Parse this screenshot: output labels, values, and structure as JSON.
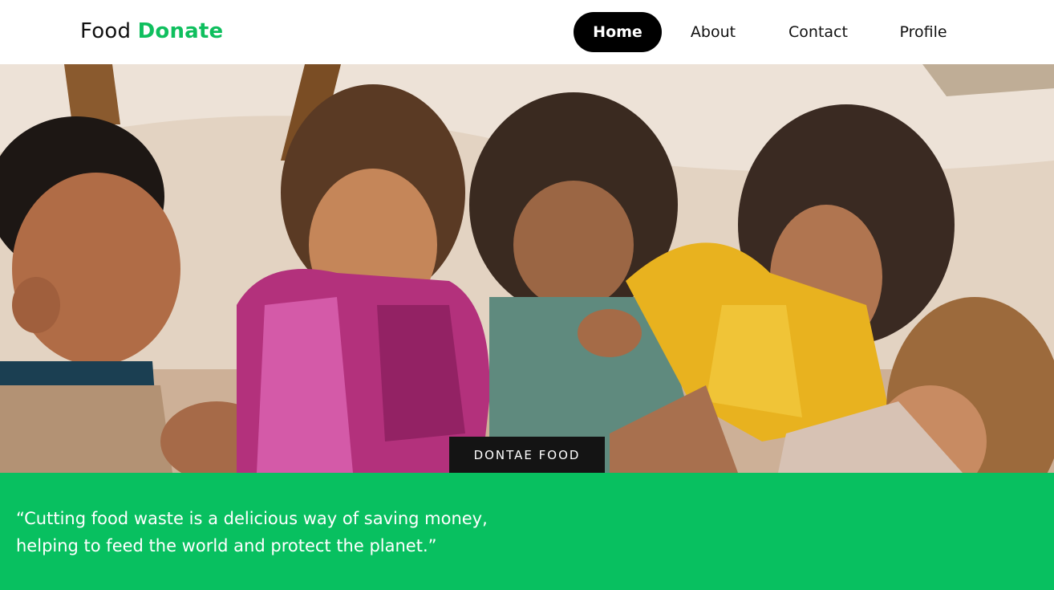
{
  "header": {
    "logo_primary": "Food",
    "logo_accent": "Donate",
    "nav": [
      {
        "label": "Home",
        "active": true
      },
      {
        "label": "About",
        "active": false
      },
      {
        "label": "Contact",
        "active": false
      },
      {
        "label": "Profile",
        "active": false
      }
    ]
  },
  "hero": {
    "image_icon": "photo-children-icon",
    "cta_label": "DONTAE FOOD"
  },
  "quote": {
    "line1": "“Cutting food waste is a delicious way of saving money,",
    "line2": "helping to feed the world and protect the planet.”"
  },
  "colors": {
    "brand_green": "#0fbf5e",
    "band_green": "#08c060",
    "nav_active_bg": "#000000",
    "cta_bg": "#141414"
  }
}
